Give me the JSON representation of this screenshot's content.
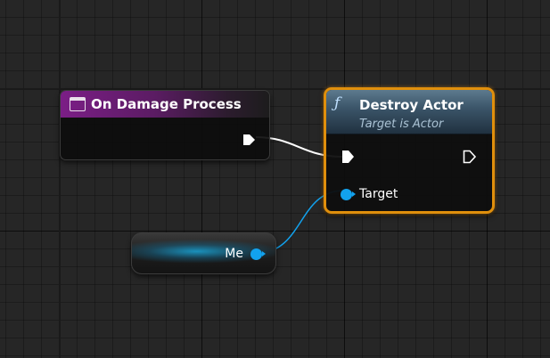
{
  "event_node": {
    "title": "On Damage Process",
    "header_color": "#7b1e86",
    "icon": "event-icon"
  },
  "function_node": {
    "title": "Destroy Actor",
    "subtitle": "Target is Actor",
    "icon": "function-icon",
    "selected": true,
    "border_color": "#e08f0c",
    "target_pin_label": "Target"
  },
  "self_node": {
    "label": "Me",
    "pin_color": "#12a2ee"
  },
  "wires": {
    "exec_color": "#ffffff",
    "object_color": "#12a2ee"
  }
}
